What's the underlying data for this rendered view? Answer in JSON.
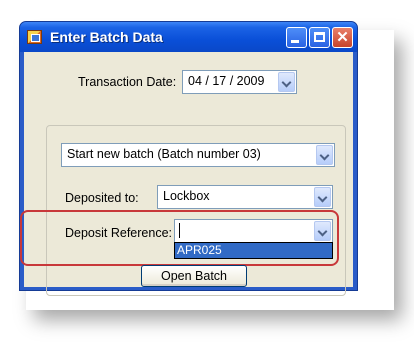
{
  "window": {
    "title": "Enter Batch Data"
  },
  "form": {
    "transaction_date_label": "Transaction Date:",
    "transaction_date_value": "04 / 17 / 2009",
    "batch_value": "Start new batch (Batch number 03)",
    "deposited_to_label": "Deposited to:",
    "deposited_to_value": "Lockbox",
    "deposit_reference_label": "Deposit Reference:",
    "deposit_reference_value": "",
    "deposit_reference_options": [
      "APR025"
    ],
    "open_batch_label": "Open Batch"
  },
  "colors": {
    "highlight": "#c8383a",
    "selection": "#316ac5"
  }
}
